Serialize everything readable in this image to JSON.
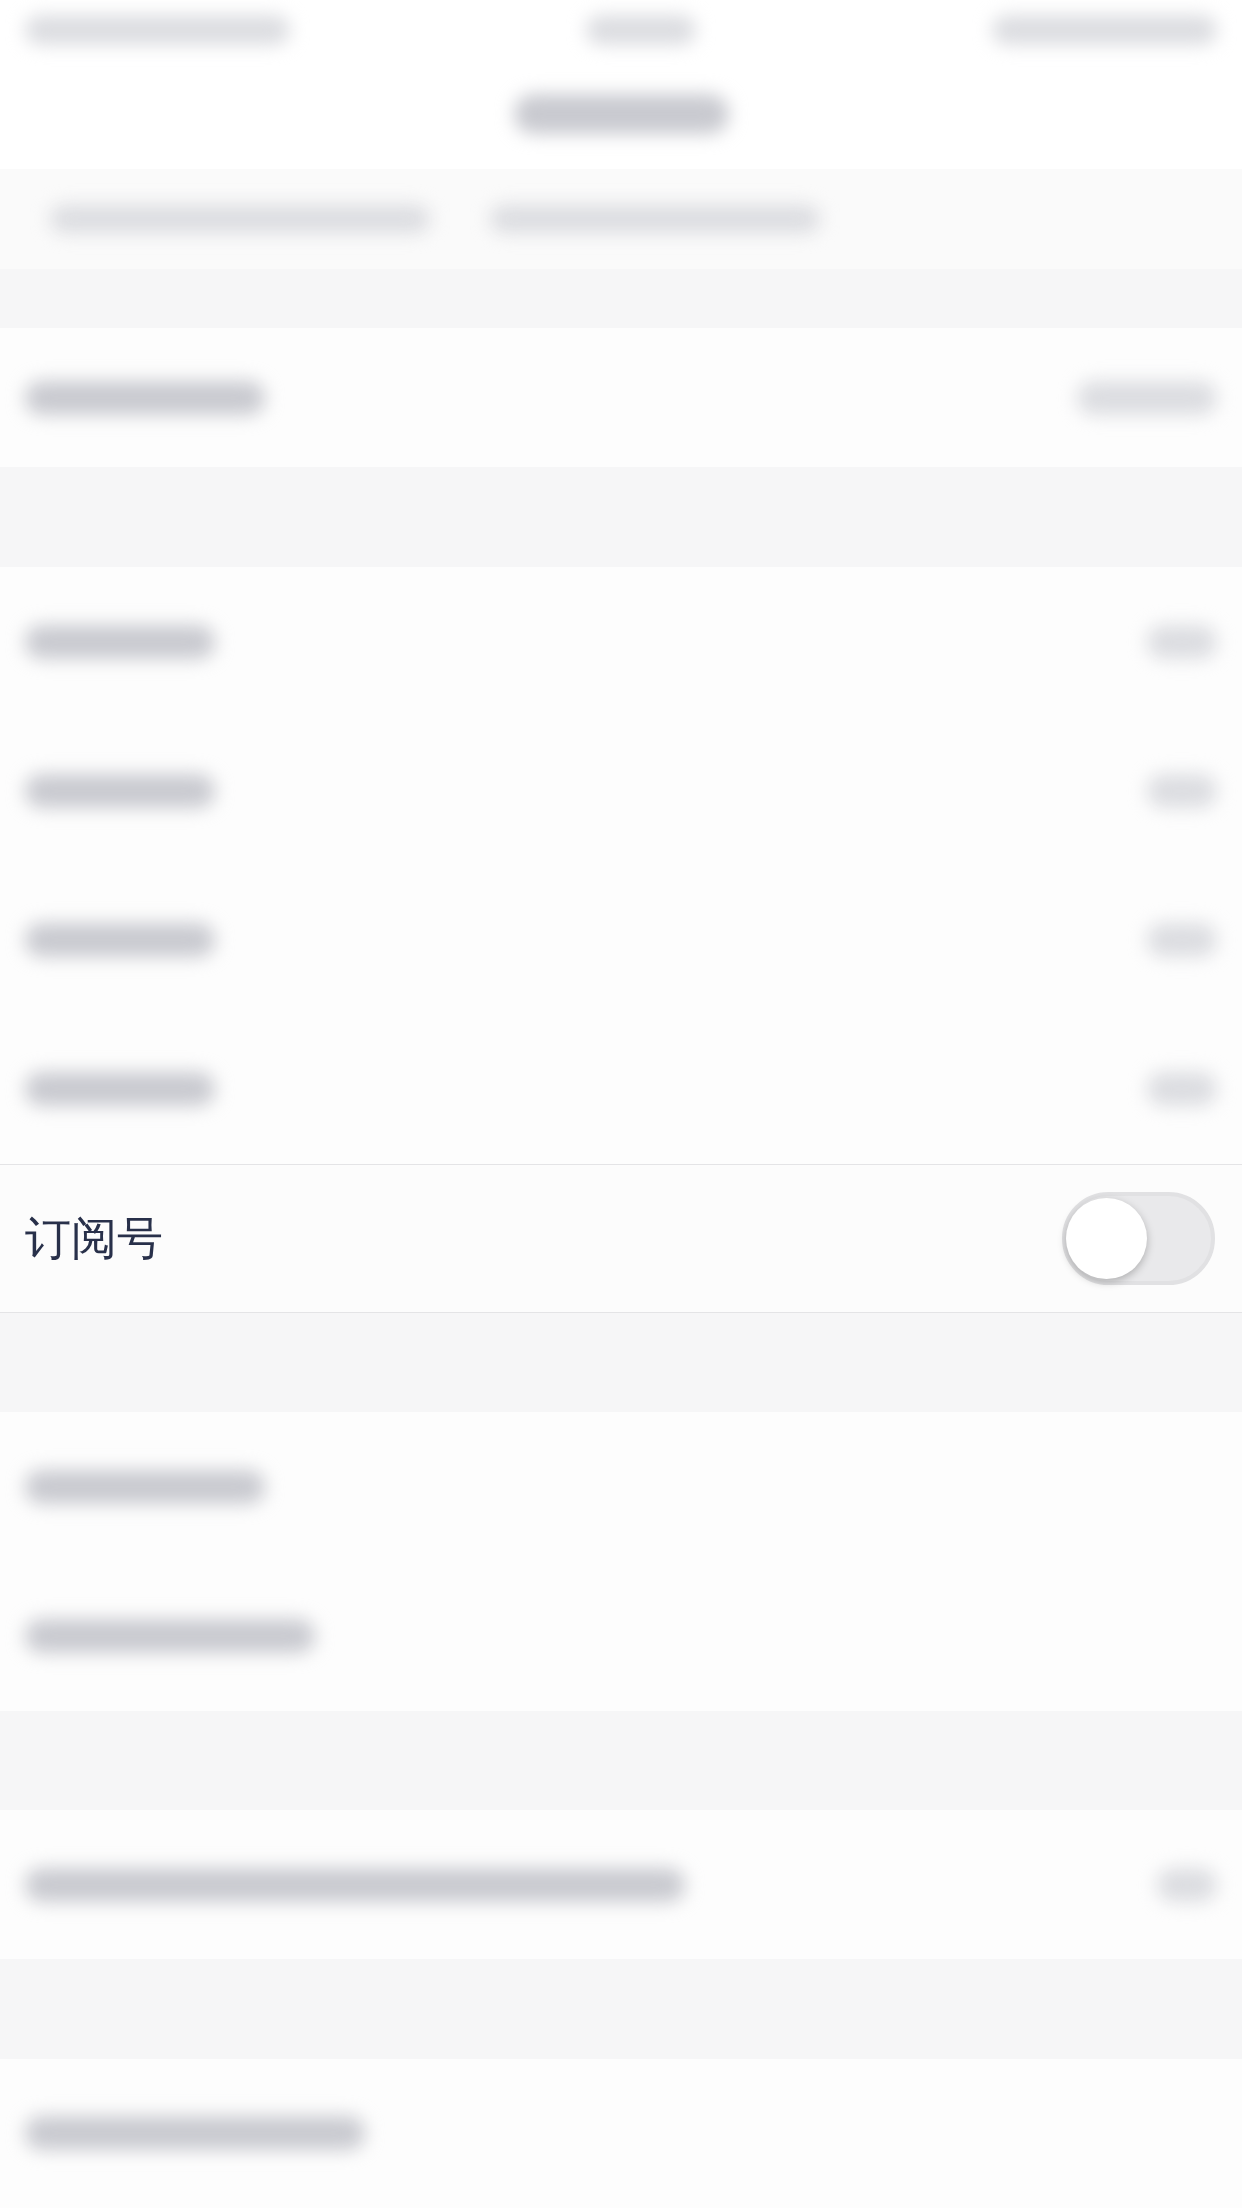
{
  "subscription_row": {
    "label": "订阅号",
    "toggle": {
      "on": false
    }
  }
}
